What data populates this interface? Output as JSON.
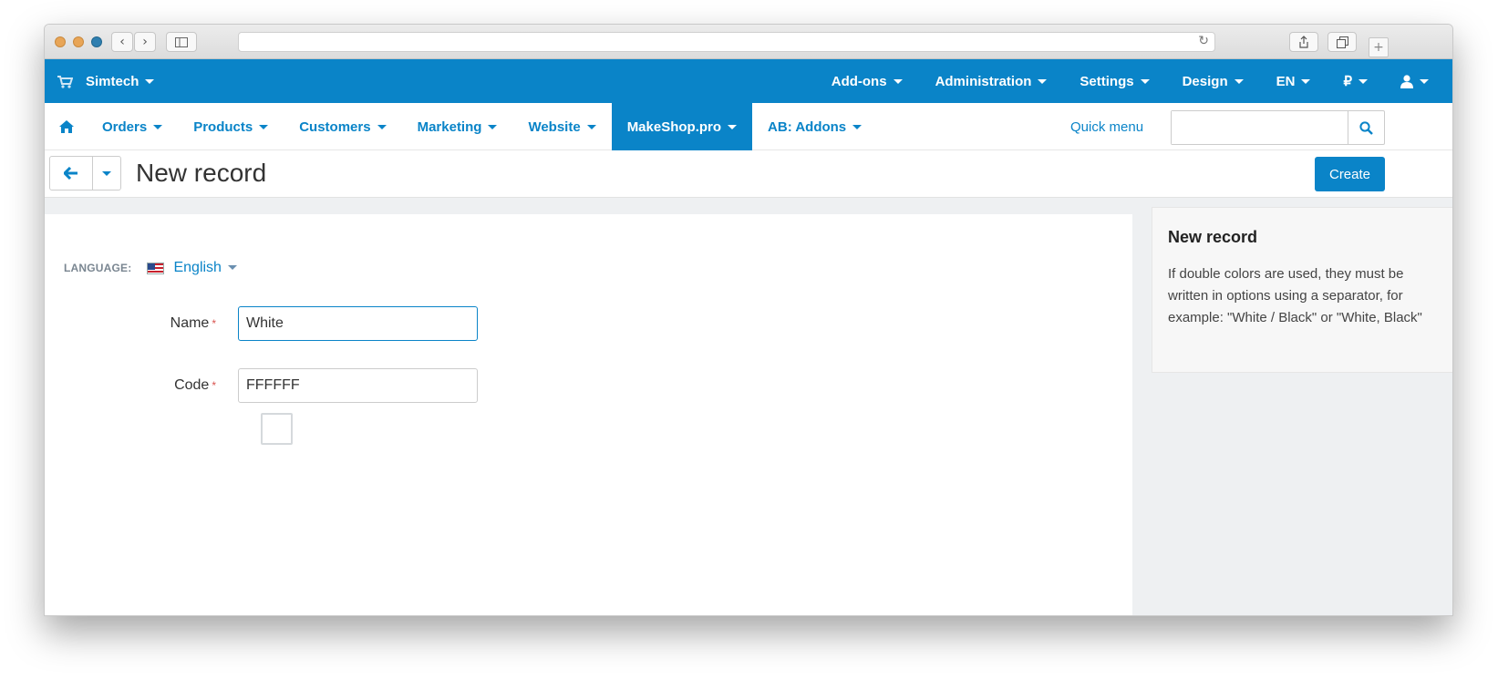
{
  "topnav": {
    "brand": "Simtech",
    "items": [
      {
        "label": "Add-ons"
      },
      {
        "label": "Administration"
      },
      {
        "label": "Settings"
      },
      {
        "label": "Design"
      },
      {
        "label": "EN"
      },
      {
        "label": "₽"
      }
    ]
  },
  "mainnav": {
    "items": [
      {
        "label": "Orders"
      },
      {
        "label": "Products"
      },
      {
        "label": "Customers"
      },
      {
        "label": "Marketing"
      },
      {
        "label": "Website"
      },
      {
        "label": "MakeShop.pro",
        "active": true
      },
      {
        "label": "AB: Addons"
      }
    ],
    "quick_menu": "Quick menu",
    "search_value": ""
  },
  "page": {
    "title": "New record",
    "create_label": "Create"
  },
  "form": {
    "language_label": "LANGUAGE:",
    "language_value": "English",
    "name_label": "Name",
    "name_value": "White",
    "code_label": "Code",
    "code_value": "FFFFFF",
    "required_mark": "*",
    "color_swatch": "#FFFFFF"
  },
  "sidebar": {
    "title": "New record",
    "text": "If double colors are used, they must be written in options using a separator, for example: \"White / Black\" or \"White, Black\""
  },
  "colors": {
    "brand_blue": "#0a84c8",
    "required": "#d9534f"
  }
}
